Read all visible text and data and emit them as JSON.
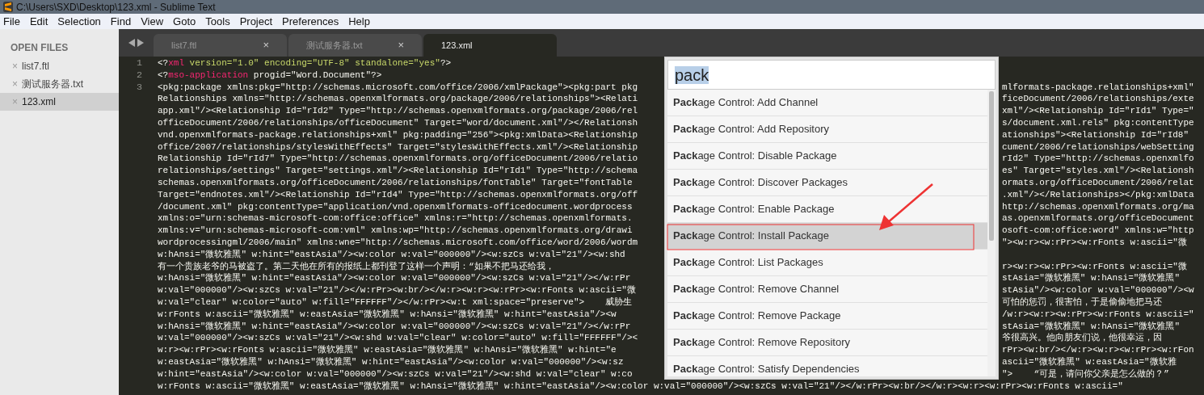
{
  "window": {
    "title": "C:\\Users\\SXD\\Desktop\\123.xml - Sublime Text"
  },
  "menu": [
    "File",
    "Edit",
    "Selection",
    "Find",
    "View",
    "Goto",
    "Tools",
    "Project",
    "Preferences",
    "Help"
  ],
  "sidebar": {
    "heading": "OPEN FILES",
    "items": [
      {
        "close": "×",
        "label": "list7.ftl",
        "selected": false
      },
      {
        "close": "×",
        "label": "测试服务器.txt",
        "selected": false
      },
      {
        "close": "×",
        "label": "123.xml",
        "selected": true
      }
    ]
  },
  "tabs": [
    {
      "label": "list7.ftl",
      "close": "×",
      "selected": false
    },
    {
      "label": "测试服务器.txt",
      "close": "×",
      "selected": false
    },
    {
      "label": "123.xml",
      "selected": true
    }
  ],
  "editor": {
    "rows": [
      {
        "kind": "split",
        "number": "1",
        "tokens": [
          {
            "kind": "punct",
            "text": "<?"
          },
          {
            "kind": "tag",
            "text": "xml"
          },
          {
            "kind": "attr",
            "text": " version=\"1.0\" encoding=\"UTF-8\" standalone=\"yes\""
          },
          {
            "kind": "punct",
            "text": "?>"
          }
        ]
      },
      {
        "kind": "split",
        "number": "2",
        "tokens": [
          {
            "kind": "punct",
            "text": "<?"
          },
          {
            "kind": "tag",
            "text": "mso-application"
          },
          {
            "kind": "punct",
            "text": " progid=\"Word.Document\"?>"
          }
        ]
      },
      {
        "kind": "split",
        "number": "3",
        "left": "<pkg:package xmlns:pkg=\"http://schemas.microsoft.com/office/2006/xmlPackage\"><pkg:part pkg",
        "right": "mlformats-package.relationships+xml\""
      },
      {
        "kind": "split",
        "left": "Relationships xmlns=\"http://schemas.openxmlformats.org/package/2006/relationships\"><Relati",
        "right": "ficeDocument/2006/relationships/exte"
      },
      {
        "kind": "split",
        "left": "app.xml\"/><Relationship Id=\"rId2\" Type=\"http://schemas.openxmlformats.org/package/2006/rel",
        "right": "xml\"/><Relationship Id=\"rId1\" Type=\""
      },
      {
        "kind": "split",
        "left": "officeDocument/2006/relationships/officeDocument\" Target=\"word/document.xml\"/></Relationsh",
        "right": "s/document.xml.rels\" pkg:contentType"
      },
      {
        "kind": "split",
        "left": "vnd.openxmlformats-package.relationships+xml\" pkg:padding=\"256\"><pkg:xmlData><Relationship",
        "right": "ationships\"><Relationship Id=\"rId8\""
      },
      {
        "kind": "split",
        "left": "office/2007/relationships/stylesWithEffects\" Target=\"stylesWithEffects.xml\"/><Relationship",
        "right": "cument/2006/relationships/webSetting"
      },
      {
        "kind": "split",
        "left": "Relationship Id=\"rId7\" Type=\"http://schemas.openxmlformats.org/officeDocument/2006/relatio",
        "right": "rId2\" Type=\"http://schemas.openxmlfo"
      },
      {
        "kind": "split",
        "left": "relationships/settings\" Target=\"settings.xml\"/><Relationship Id=\"rId1\" Type=\"http://schema",
        "right": "es\" Target=\"styles.xml\"/><Relationsh"
      },
      {
        "kind": "split",
        "left": "schemas.openxmlformats.org/officeDocument/2006/relationships/fontTable\" Target=\"fontTable",
        "right": "ormats.org/officeDocument/2006/relat"
      },
      {
        "kind": "split",
        "left": "Target=\"endnotes.xml\"/><Relationship Id=\"rId4\" Type=\"http://schemas.openxmlformats.org/off",
        "right": ".xml\"/></Relationships></pkg:xmlData"
      },
      {
        "kind": "split",
        "left": "/document.xml\" pkg:contentType=\"application/vnd.openxmlformats-officedocument.wordprocess",
        "right": "http://schemas.openxmlformats.org/ma"
      },
      {
        "kind": "split",
        "left": "xmlns:o=\"urn:schemas-microsoft-com:office:office\" xmlns:r=\"http://schemas.openxmlformats.",
        "right": "as.openxmlformats.org/officeDocument"
      },
      {
        "kind": "split",
        "left": "xmlns:v=\"urn:schemas-microsoft-com:vml\" xmlns:wp=\"http://schemas.openxmlformats.org/drawi",
        "right": "osoft-com:office:word\" xmlns:w=\"http"
      },
      {
        "kind": "split",
        "left": "wordprocessingml/2006/main\" xmlns:wne=\"http://schemas.microsoft.com/office/word/2006/wordm",
        "right": "\"><w:r><w:rPr><w:rFonts w:ascii=\"微"
      },
      {
        "kind": "split",
        "left": "w:hAnsi=\"微软雅黑\" w:hint=\"eastAsia\"/><w:color w:val=\"000000\"/><w:szCs w:val=\"21\"/><w:shd"
      },
      {
        "kind": "split",
        "left": "有一个贵族老爷的马被盗了。第二天他在所有的报纸上都刊登了这样一个声明：“如果不把马还给我，",
        "right": "r><w:r><w:rPr><w:rFonts w:ascii=\"微"
      },
      {
        "kind": "split",
        "left": "w:hAnsi=\"微软雅黑\" w:hint=\"eastAsia\"/><w:color w:val=\"000000\"/><w:szCs w:val=\"21\"/></w:rPr",
        "right": "stAsia=\"微软雅黑\" w:hAnsi=\"微软雅黑\""
      },
      {
        "kind": "split",
        "left": "w:val=\"000000\"/><w:szCs w:val=\"21\"/></w:rPr><w:br/></w:r><w:r><w:rPr><w:rFonts w:ascii=\"微",
        "right": "stAsia\"/><w:color w:val=\"000000\"/><w"
      },
      {
        "kind": "split",
        "left": "w:val=\"clear\" w:color=\"auto\" w:fill=\"FFFFFF\"/></w:rPr><w:t xml:space=\"preserve\">    威胁生",
        "right": "可怕的惩罚，很害怕，于是偷偷地把马还"
      },
      {
        "kind": "split",
        "left": "w:rFonts w:ascii=\"微软雅黑\" w:eastAsia=\"微软雅黑\" w:hAnsi=\"微软雅黑\" w:hint=\"eastAsia\"/><w",
        "right": "/w:r><w:r><w:rPr><w:rFonts w:ascii=\""
      },
      {
        "kind": "split",
        "left": "w:hAnsi=\"微软雅黑\" w:hint=\"eastAsia\"/><w:color w:val=\"000000\"/><w:szCs w:val=\"21\"/></w:rPr",
        "right": "stAsia=\"微软雅黑\" w:hAnsi=\"微软雅黑\""
      },
      {
        "kind": "split",
        "left": "w:val=\"000000\"/><w:szCs w:val=\"21\"/><w:shd w:val=\"clear\" w:color=\"auto\" w:fill=\"FFFFFF\"/><",
        "right": "爷很高兴。他向朋友们说，他很幸运，因"
      },
      {
        "kind": "split",
        "left": "w:r><w:rPr><w:rFonts w:ascii=\"微软雅黑\" w:eastAsia=\"微软雅黑\" w:hAnsi=\"微软雅黑\" w:hint=\"e",
        "right": "rPr><w:br/></w:r><w:r><w:rPr><w:rFon"
      },
      {
        "kind": "split",
        "left": "w:eastAsia=\"微软雅黑\" w:hAnsi=\"微软雅黑\" w:hint=\"eastAsia\"/><w:color w:val=\"000000\"/><w:sz",
        "right": "ascii=\"微软雅黑\" w:eastAsia=\"微软雅"
      },
      {
        "kind": "split",
        "left": "w:hint=\"eastAsia\"/><w:color w:val=\"000000\"/><w:szCs w:val=\"21\"/><w:shd w:val=\"clear\" w:co",
        "right": "\">    “可是，请问你父亲是怎么做的？”"
      },
      {
        "kind": "full",
        "left": "w:rFonts w:ascii=\"微软雅黑\" w:eastAsia=\"微软雅黑\" w:hAnsi=\"微软雅黑\" w:hint=\"eastAsia\"/><w:color w:val=\"000000\"/><w:szCs w:val=\"21\"/></w:rPr><w:br/></w:r><w:r><w:rPr><w:rFonts w:ascii=\""
      }
    ]
  },
  "palette": {
    "query": "pack",
    "items": [
      {
        "label": "**Pack**age Control: Add Channel",
        "selected": false
      },
      {
        "label": "**Pack**age Control: Add Repository",
        "selected": false
      },
      {
        "label": "**Pack**age Control: Disable Package",
        "selected": false
      },
      {
        "label": "**Pack**age Control: Discover Packages",
        "selected": false
      },
      {
        "label": "**Pack**age Control: Enable Package",
        "selected": false
      },
      {
        "label": "**Pack**age Control: Install Package",
        "selected": true
      },
      {
        "label": "**Pack**age Control: List Packages",
        "selected": false
      },
      {
        "label": "**Pack**age Control: Remove Channel",
        "selected": false
      },
      {
        "label": "**Pack**age Control: Remove Package",
        "selected": false
      },
      {
        "label": "**Pack**age Control: Remove Repository",
        "selected": false
      },
      {
        "label": "**Pack**age Control: Satisfy Dependencies",
        "selected": false
      }
    ]
  }
}
